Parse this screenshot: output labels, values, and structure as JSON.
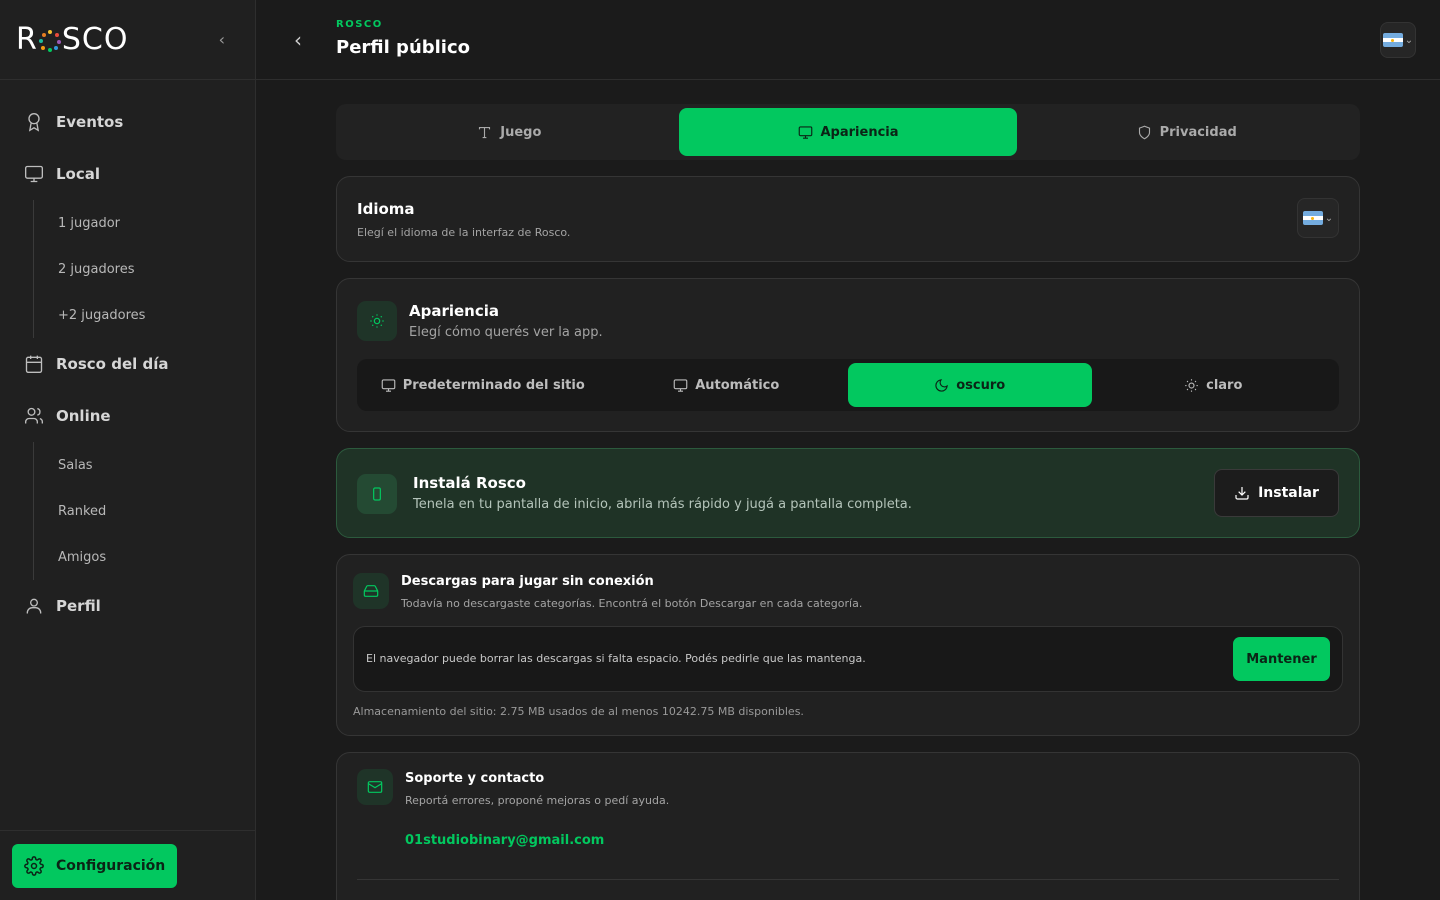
{
  "sidebar": {
    "logo": {
      "left": "R",
      "right": "SCO"
    },
    "items": [
      {
        "label": "Eventos"
      },
      {
        "label": "Local",
        "children": [
          "1 jugador",
          "2 jugadores",
          "+2 jugadores"
        ]
      },
      {
        "label": "Rosco del día"
      },
      {
        "label": "Online",
        "children": [
          "Salas",
          "Ranked",
          "Amigos"
        ]
      },
      {
        "label": "Perfil"
      }
    ],
    "config_label": "Configuración"
  },
  "header": {
    "breadcrumb": "ROSCO",
    "title": "Perfil público"
  },
  "tabs": [
    {
      "label": "Juego",
      "icon": "type-icon"
    },
    {
      "label": "Apariencia",
      "icon": "monitor-icon",
      "active": true
    },
    {
      "label": "Privacidad",
      "icon": "shield-icon"
    }
  ],
  "idioma": {
    "title": "Idioma",
    "subtitle": "Elegí el idioma de la interfaz de Rosco."
  },
  "apariencia": {
    "title": "Apariencia",
    "subtitle": "Elegí cómo querés ver la app.",
    "options": [
      {
        "label": "Predeterminado del sitio"
      },
      {
        "label": "Automático"
      },
      {
        "label": "oscuro",
        "active": true
      },
      {
        "label": "claro"
      }
    ]
  },
  "install": {
    "title": "Instalá Rosco",
    "subtitle": "Tenela en tu pantalla de inicio, abrila más rápido y jugá a pantalla completa.",
    "button": "Instalar"
  },
  "downloads": {
    "title": "Descargas para jugar sin conexión",
    "subtitle": "Todavía no descargaste categorías. Encontrá el botón Descargar en cada categoría.",
    "notice": "El navegador puede borrar las descargas si falta espacio. Podés pedirle que las mantenga.",
    "keep_button": "Mantener",
    "storage": "Almacenamiento del sitio: 2.75 MB usados de al menos 10242.75 MB disponibles."
  },
  "support": {
    "title": "Soporte y contacto",
    "subtitle": "Reportá errores, proponé mejoras o pedí ayuda.",
    "email": "01studiobinary@gmail.com"
  },
  "colors": {
    "accent": "#02c85f",
    "background": "#1b1b1b",
    "card": "#212121"
  }
}
